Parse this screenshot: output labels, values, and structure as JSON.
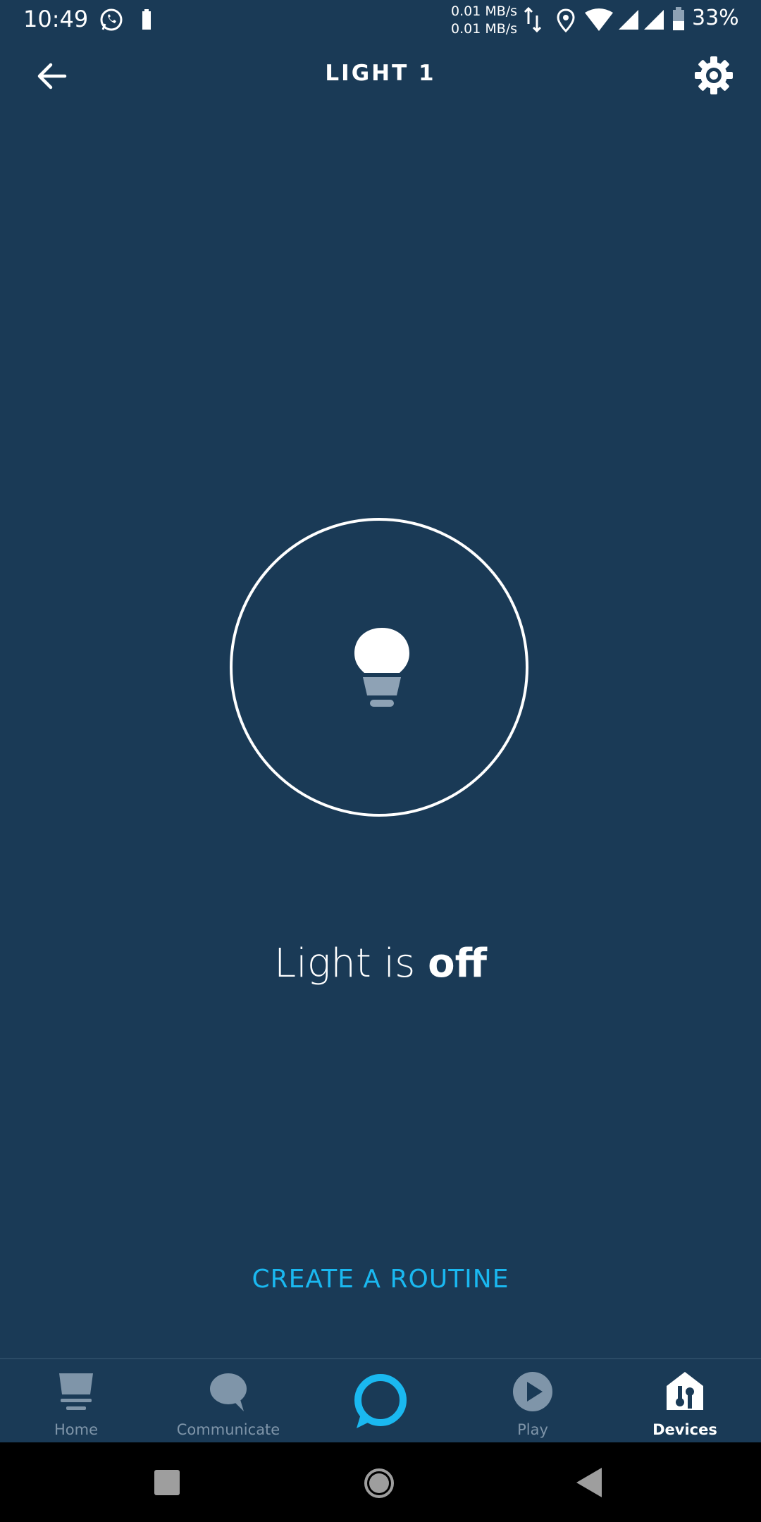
{
  "status_bar": {
    "time": "10:49",
    "speed_up": "0.01 MB/s",
    "speed_down": "0.01 MB/s",
    "battery_percent": "33%"
  },
  "header": {
    "title": "LIGHT 1"
  },
  "device": {
    "status_prefix": "Light is ",
    "status_value": "off"
  },
  "actions": {
    "create_routine": "CREATE A ROUTINE"
  },
  "bottom_nav": {
    "items": [
      {
        "label": "Home",
        "icon": "home-icon"
      },
      {
        "label": "Communicate",
        "icon": "speech-bubble-icon"
      },
      {
        "label": "",
        "icon": "alexa-ring-icon"
      },
      {
        "label": "Play",
        "icon": "play-icon"
      },
      {
        "label": "Devices",
        "icon": "devices-icon",
        "active": true
      }
    ]
  },
  "colors": {
    "background": "#1a3a56",
    "accent": "#1ab8f0",
    "inactive": "#7f95a9"
  }
}
